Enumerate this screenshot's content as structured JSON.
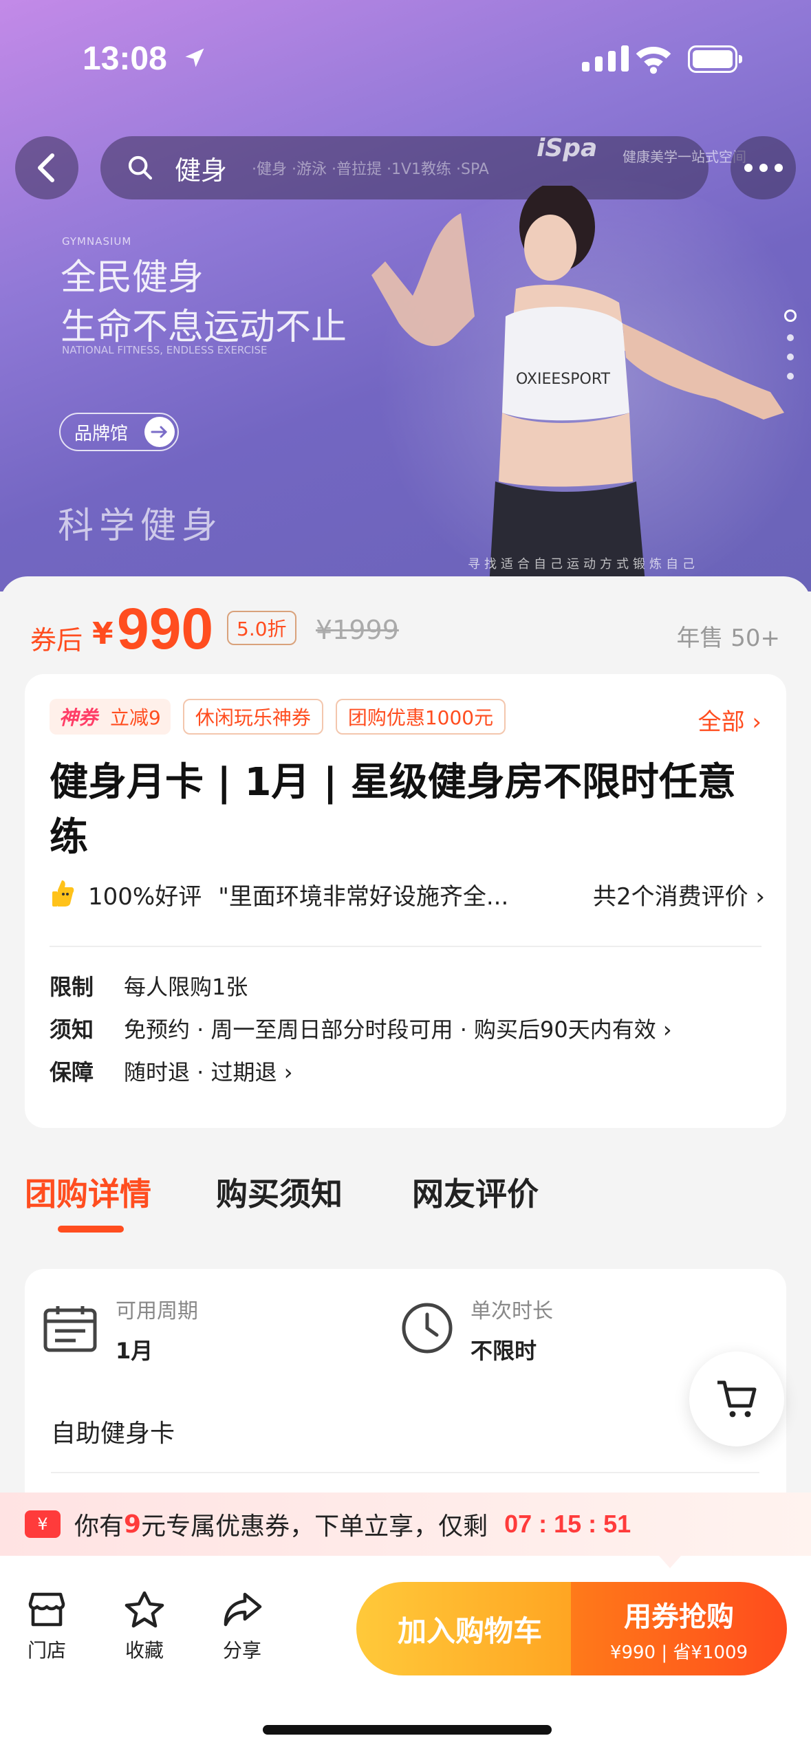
{
  "status_bar": {
    "time": "13:08"
  },
  "nav": {
    "search_text": "健身",
    "hint_text": "·健身 ·游泳 ·普拉提 ·1V1教练 ·SPA",
    "brand": "iSpa",
    "brand_sub": "健康美学一站式空间"
  },
  "banner": {
    "tag_en": "GYMNASIUM",
    "slogan_line1": "全民健身",
    "slogan_line2": "生命不息运动不止",
    "slogan_en": "NATIONAL FITNESS, ENDLESS EXERCISE",
    "brand_hall": "品牌馆",
    "science": "科学健身",
    "bottom_text": "寻找适合自己运动方式锻炼自己",
    "shirt_text": "OXIEESPORT"
  },
  "price": {
    "after_label": "券后",
    "currency": "¥",
    "value": "990",
    "discount": "5.0折",
    "original": "¥1999",
    "sold": "年售 50+"
  },
  "coupons": [
    {
      "brand": "神券",
      "label": "立减9"
    },
    {
      "label": "休闲玩乐神券"
    },
    {
      "label": "团购优惠1000元"
    }
  ],
  "coupon_all": "全部 ›",
  "product_title": "健身月卡 | 1月 | 星级健身房不限时任意练",
  "review": {
    "rate": "100%好评",
    "quote": "\"里面环境非常好设施齐全...",
    "total": "共2个消费评价 ›"
  },
  "rules": [
    {
      "key": "限制",
      "value": "每人限购1张"
    },
    {
      "key": "须知",
      "value": "免预约 · 周一至周日部分时段可用 · 购买后90天内有效 ›"
    },
    {
      "key": "保障",
      "value": "随时退 · 过期退 ›"
    }
  ],
  "tabs": [
    "团购详情",
    "购买须知",
    "网友评价"
  ],
  "details": {
    "period_label": "可用周期",
    "period_value": "1月",
    "duration_label": "单次时长",
    "duration_value": "不限时",
    "item": "自助健身卡"
  },
  "coupon_bar": {
    "ticket": "¥",
    "prefix": "你有",
    "amount": "9",
    "suffix": "元专属优惠券，下单立享，仅剩",
    "countdown": "07 : 15 : 51"
  },
  "bottom_bar": {
    "store": "门店",
    "favorite": "收藏",
    "share": "分享",
    "add_cart": "加入购物车",
    "buy_title": "用券抢购",
    "buy_sub": "¥990 | 省¥1009"
  },
  "colors": {
    "accent": "#ff4d1f",
    "cart_btn": "#ffb22e",
    "buy_btn": "#ff5a1c"
  }
}
